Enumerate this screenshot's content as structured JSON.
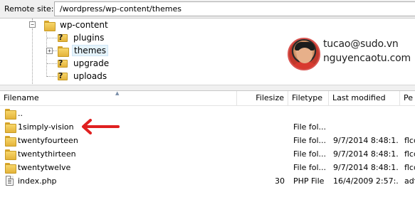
{
  "site_bar": {
    "label": "Remote site:",
    "path": "/wordpress/wp-content/themes"
  },
  "tree": {
    "parent": {
      "label": "wp-content",
      "expander": "−"
    },
    "children": [
      {
        "label": "plugins",
        "icon": "question-folder-icon"
      },
      {
        "label": "themes",
        "icon": "folder-icon",
        "expander": "+",
        "selected": true
      },
      {
        "label": "upgrade",
        "icon": "question-folder-icon"
      },
      {
        "label": "uploads",
        "icon": "question-folder-icon"
      }
    ]
  },
  "watermark": {
    "email": "tucao@sudo.vn",
    "site": "nguyencaotu.com"
  },
  "list": {
    "columns": {
      "filename": "Filename",
      "filesize": "Filesize",
      "filetype": "Filetype",
      "last_modified": "Last modified",
      "permissions": "Pe"
    },
    "rows": [
      {
        "name": "..",
        "size": "",
        "type": "",
        "modified": "",
        "perms": "",
        "icon": "folder-icon"
      },
      {
        "name": "1simply-vision",
        "size": "",
        "type": "File fol...",
        "modified": "",
        "perms": "",
        "icon": "folder-icon"
      },
      {
        "name": "twentyfourteen",
        "size": "",
        "type": "File fol...",
        "modified": "9/7/2014 8:48:1...",
        "perms": "flcd",
        "icon": "folder-icon"
      },
      {
        "name": "twentythirteen",
        "size": "",
        "type": "File fol...",
        "modified": "9/7/2014 8:48:1...",
        "perms": "flcd",
        "icon": "folder-icon"
      },
      {
        "name": "twentytwelve",
        "size": "",
        "type": "File fol...",
        "modified": "9/7/2014 8:48:1...",
        "perms": "flcd",
        "icon": "folder-icon"
      },
      {
        "name": "index.php",
        "size": "30",
        "type": "PHP File",
        "modified": "16/4/2009 2:57:...",
        "perms": "adf",
        "icon": "php-file-icon"
      }
    ]
  },
  "annotation": {
    "arrow_color": "#e02020"
  }
}
